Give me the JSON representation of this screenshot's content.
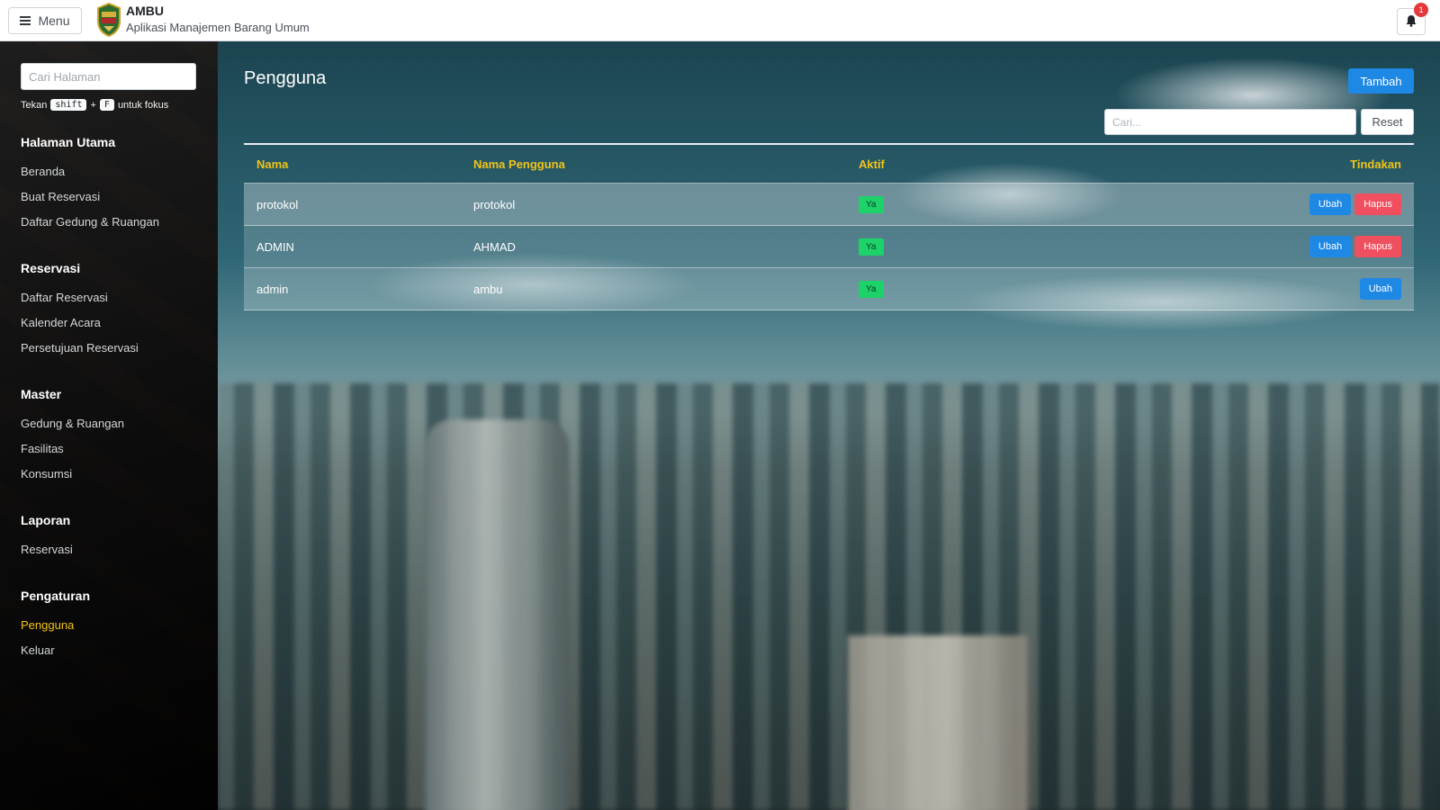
{
  "header": {
    "menu_label": "Menu",
    "app_title": "AMBU",
    "app_subtitle": "Aplikasi Manajemen Barang Umum",
    "notification_count": "1"
  },
  "sidebar": {
    "search_placeholder": "Cari Halaman",
    "hint_prefix": "Tekan",
    "hint_key1": "shift",
    "hint_plus": "+",
    "hint_key2": "F",
    "hint_suffix": "untuk fokus",
    "sections": [
      {
        "title": "Halaman Utama",
        "items": [
          "Beranda",
          "Buat Reservasi",
          "Daftar Gedung & Ruangan"
        ]
      },
      {
        "title": "Reservasi",
        "items": [
          "Daftar Reservasi",
          "Kalender Acara",
          "Persetujuan Reservasi"
        ]
      },
      {
        "title": "Master",
        "items": [
          "Gedung & Ruangan",
          "Fasilitas",
          "Konsumsi"
        ]
      },
      {
        "title": "Laporan",
        "items": [
          "Reservasi"
        ]
      },
      {
        "title": "Pengaturan",
        "items": [
          "Pengguna",
          "Keluar"
        ]
      }
    ],
    "active_item": "Pengguna"
  },
  "main": {
    "title": "Pengguna",
    "add_label": "Tambah",
    "search_placeholder": "Cari...",
    "reset_label": "Reset",
    "columns": [
      "Nama",
      "Nama Pengguna",
      "Aktif",
      "Tindakan"
    ],
    "rows": [
      {
        "nama": "protokol",
        "username": "protokol",
        "aktif": "Ya",
        "actions": [
          "Ubah",
          "Hapus"
        ]
      },
      {
        "nama": "ADMIN",
        "username": "AHMAD",
        "aktif": "Ya",
        "actions": [
          "Ubah",
          "Hapus"
        ]
      },
      {
        "nama": "admin",
        "username": "ambu",
        "aktif": "Ya",
        "actions": [
          "Ubah"
        ]
      }
    ]
  },
  "colors": {
    "primary": "#1e88e5",
    "danger": "#ef4f5e",
    "success": "#1ed26a",
    "accent_yellow": "#f0c419"
  }
}
